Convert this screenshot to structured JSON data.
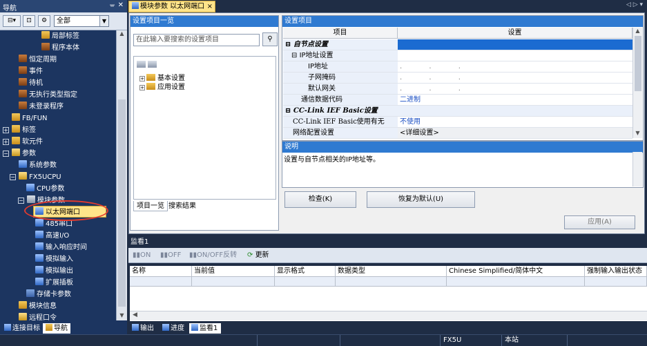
{
  "nav": {
    "title": "导航",
    "pin_icon": "pin-icon",
    "close_icon": "close-icon",
    "select_value": "全部",
    "tree": [
      {
        "label": "局部标签",
        "icon": "folder"
      },
      {
        "label": "程序本体",
        "icon": "prog"
      },
      {
        "label": "恒定周期",
        "icon": "prog"
      },
      {
        "label": "事件",
        "icon": "prog"
      },
      {
        "label": "待机",
        "icon": "prog"
      },
      {
        "label": "无执行类型指定",
        "icon": "prog"
      },
      {
        "label": "未登录程序",
        "icon": "prog"
      },
      {
        "label": "FB/FUN",
        "icon": "folder"
      },
      {
        "label": "标签",
        "icon": "folder"
      },
      {
        "label": "软元件",
        "icon": "folder"
      },
      {
        "label": "参数",
        "icon": "gear"
      },
      {
        "label": "系统参数",
        "icon": "blue"
      },
      {
        "label": "FX5UCPU",
        "icon": "gear"
      },
      {
        "label": "CPU参数",
        "icon": "blue"
      },
      {
        "label": "模块参数",
        "icon": "gear"
      },
      {
        "label": "以太网端口",
        "icon": "blue"
      },
      {
        "label": "485串口",
        "icon": "blue"
      },
      {
        "label": "高速I/O",
        "icon": "blue"
      },
      {
        "label": "输入响应时间",
        "icon": "blue"
      },
      {
        "label": "模拟输入",
        "icon": "blue"
      },
      {
        "label": "模拟输出",
        "icon": "blue"
      },
      {
        "label": "扩展插板",
        "icon": "blue"
      },
      {
        "label": "存储卡参数",
        "icon": "doc"
      },
      {
        "label": "模块信息",
        "icon": "folder"
      },
      {
        "label": "远程口令",
        "icon": "gear"
      }
    ],
    "bottom_tabs": [
      "连接目标",
      "导航"
    ]
  },
  "doc_tab": {
    "label": "模块参数 以太网端口",
    "close": "×"
  },
  "left_pane": {
    "header": "设置项目一览",
    "search_placeholder": "在此输入要搜索的设置项目",
    "tree": [
      "基本设置",
      "应用设置"
    ],
    "tabs": [
      "项目一览",
      "搜索结果"
    ]
  },
  "right_pane": {
    "header": "设置项目",
    "col_item": "项目",
    "col_setting": "设置",
    "rows": [
      {
        "item": "自节点设置",
        "value": "",
        "type": "section",
        "indent": 0
      },
      {
        "item": "IP地址设置",
        "value": "",
        "type": "sub",
        "indent": 1
      },
      {
        "item": "IP地址",
        "value": ". . .",
        "type": "ip",
        "indent": 2
      },
      {
        "item": "子网掩码",
        "value": ". . .",
        "type": "ip",
        "indent": 2
      },
      {
        "item": "默认网关",
        "value": ". . .",
        "type": "ip",
        "indent": 2
      },
      {
        "item": "通信数据代码",
        "value": "二进制",
        "type": "plain",
        "indent": 1
      },
      {
        "item": "CC-Link IEF Basic设置",
        "value": "",
        "type": "section",
        "indent": 0
      },
      {
        "item": "CC-Link IEF Basic使用有无",
        "value": "不使用",
        "type": "plain",
        "indent": 1
      },
      {
        "item": "网络配置设置",
        "value": "<详细设置>",
        "type": "plain",
        "indent": 1
      }
    ],
    "desc_header": "说明",
    "desc_text": "设置与自节点相关的IP地址等。",
    "btn_check": "检查(K)",
    "btn_restore": "恢复为默认(U)",
    "btn_apply": "应用(A)"
  },
  "watch": {
    "title": "监看1",
    "toolbar": [
      "ON",
      "OFF",
      "ON/OFF反转",
      "更新"
    ],
    "columns": [
      "名称",
      "当前值",
      "显示格式",
      "数据类型",
      "Chinese Simplified/简体中文",
      "强制输入输出状态"
    ],
    "bottom_tabs": [
      "输出",
      "进度",
      "监看1"
    ]
  },
  "status": [
    "FX5U",
    "本站"
  ]
}
